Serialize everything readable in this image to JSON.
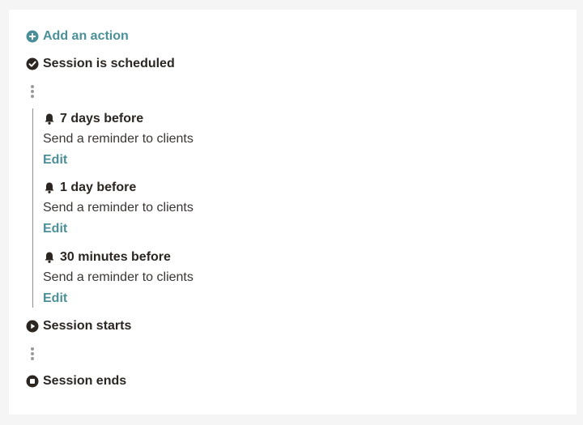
{
  "add_action": {
    "label": "Add an action",
    "icon": "plus-circle-icon"
  },
  "milestones": {
    "scheduled": {
      "label": "Session is scheduled",
      "icon": "check-circle-icon"
    },
    "starts": {
      "label": "Session starts",
      "icon": "play-circle-icon"
    },
    "ends": {
      "label": "Session ends",
      "icon": "stop-circle-icon"
    }
  },
  "reminders": [
    {
      "timing": "7 days before",
      "description": "Send a reminder to clients",
      "edit_label": "Edit",
      "icon": "bell-icon"
    },
    {
      "timing": "1 day before",
      "description": "Send a reminder to clients",
      "edit_label": "Edit",
      "icon": "bell-icon"
    },
    {
      "timing": "30 minutes before",
      "description": "Send a reminder to clients",
      "edit_label": "Edit",
      "icon": "bell-icon"
    }
  ],
  "colors": {
    "accent": "#4b9099",
    "text": "#2b2622",
    "background": "#f5f5f5"
  }
}
